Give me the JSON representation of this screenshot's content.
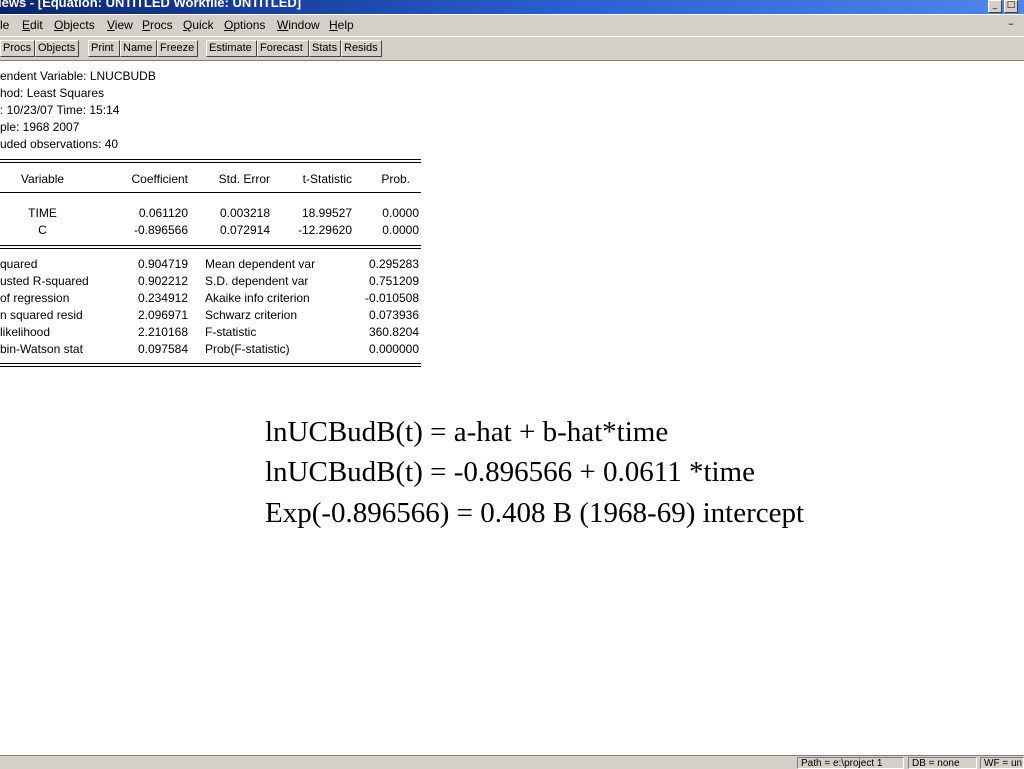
{
  "window": {
    "title": "iews - [Equation: UNTITLED   Workfile: UNTITLED]"
  },
  "menu": {
    "items": [
      "le",
      "Edit",
      "Objects",
      "View",
      "Procs",
      "Quick",
      "Options",
      "Window",
      "Help"
    ]
  },
  "toolbar": {
    "buttons": [
      "Procs",
      "Objects",
      "Print",
      "Name",
      "Freeze",
      "Estimate",
      "Forecast",
      "Stats",
      "Resids"
    ]
  },
  "output": {
    "header": [
      "endent Variable: LNUCBUDB",
      "hod: Least Squares",
      ": 10/23/07   Time: 15:14",
      "ple: 1968 2007",
      "uded observations: 40"
    ],
    "columns": [
      "Variable",
      "Coefficient",
      "Std. Error",
      "t-Statistic",
      "Prob."
    ],
    "coef_rows": [
      [
        "TIME",
        "0.061120",
        "0.003218",
        "18.99527",
        "0.0000"
      ],
      [
        "C",
        "-0.896566",
        "0.072914",
        "-12.29620",
        "0.0000"
      ]
    ],
    "stats_rows": [
      [
        "quared",
        "0.904719",
        "Mean dependent var",
        "0.295283"
      ],
      [
        "usted R-squared",
        "0.902212",
        "S.D. dependent var",
        "0.751209"
      ],
      [
        " of regression",
        "0.234912",
        "Akaike info criterion",
        "-0.010508"
      ],
      [
        "n squared resid",
        "2.096971",
        "Schwarz criterion",
        "0.073936"
      ],
      [
        " likelihood",
        "2.210168",
        "F-statistic",
        "360.8204"
      ],
      [
        "bin-Watson stat",
        "0.097584",
        "Prob(F-statistic)",
        "0.000000"
      ]
    ]
  },
  "overlay": {
    "line1": "lnUCBudB(t) = a-hat + b-hat*time",
    "line2": "lnUCBudB(t) = -0.896566 + 0.0611 *time",
    "line3": "Exp(-0.896566) = 0.408 B (1968-69) intercept"
  },
  "statusbar": {
    "path": "Path = e:\\project 1",
    "db": "DB = none",
    "wf": "WF = un"
  }
}
